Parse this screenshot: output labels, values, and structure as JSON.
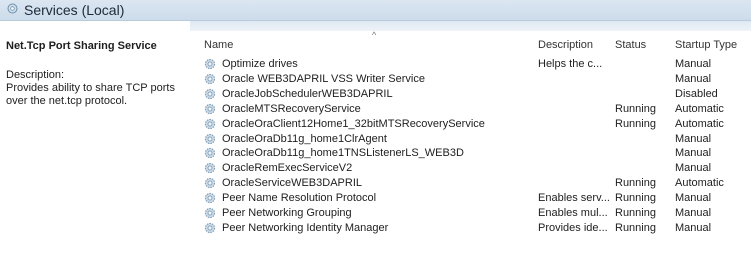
{
  "header": {
    "title": "Services (Local)",
    "icon": "services-gear-icon"
  },
  "left_panel": {
    "service_name": "Net.Tcp Port Sharing Service",
    "description_label": "Description:",
    "description": "Provides ability to share TCP ports over the net.tcp protocol."
  },
  "table": {
    "columns": [
      "Name",
      "Description",
      "Status",
      "Startup Type"
    ],
    "sort_indicator": "^",
    "rows": [
      {
        "name": "Optimize drives",
        "description": "Helps the c...",
        "status": "",
        "startup": "Manual"
      },
      {
        "name": "Oracle WEB3DAPRIL VSS Writer Service",
        "description": "",
        "status": "",
        "startup": "Manual"
      },
      {
        "name": "OracleJobSchedulerWEB3DAPRIL",
        "description": "",
        "status": "",
        "startup": "Disabled"
      },
      {
        "name": "OracleMTSRecoveryService",
        "description": "",
        "status": "Running",
        "startup": "Automatic"
      },
      {
        "name": "OracleOraClient12Home1_32bitMTSRecoveryService",
        "description": "",
        "status": "Running",
        "startup": "Automatic"
      },
      {
        "name": "OracleOraDb11g_home1ClrAgent",
        "description": "",
        "status": "",
        "startup": "Manual"
      },
      {
        "name": "OracleOraDb11g_home1TNSListenerLS_WEB3D",
        "description": "",
        "status": "",
        "startup": "Manual"
      },
      {
        "name": "OracleRemExecServiceV2",
        "description": "",
        "status": "",
        "startup": "Manual"
      },
      {
        "name": "OracleServiceWEB3DAPRIL",
        "description": "",
        "status": "Running",
        "startup": "Automatic"
      },
      {
        "name": "Peer Name Resolution Protocol",
        "description": "Enables serv...",
        "status": "Running",
        "startup": "Manual"
      },
      {
        "name": "Peer Networking Grouping",
        "description": "Enables mul...",
        "status": "Running",
        "startup": "Manual"
      },
      {
        "name": "Peer Networking Identity Manager",
        "description": "Provides ide...",
        "status": "Running",
        "startup": "Manual"
      }
    ],
    "row_icon": "service-gear-icon"
  }
}
